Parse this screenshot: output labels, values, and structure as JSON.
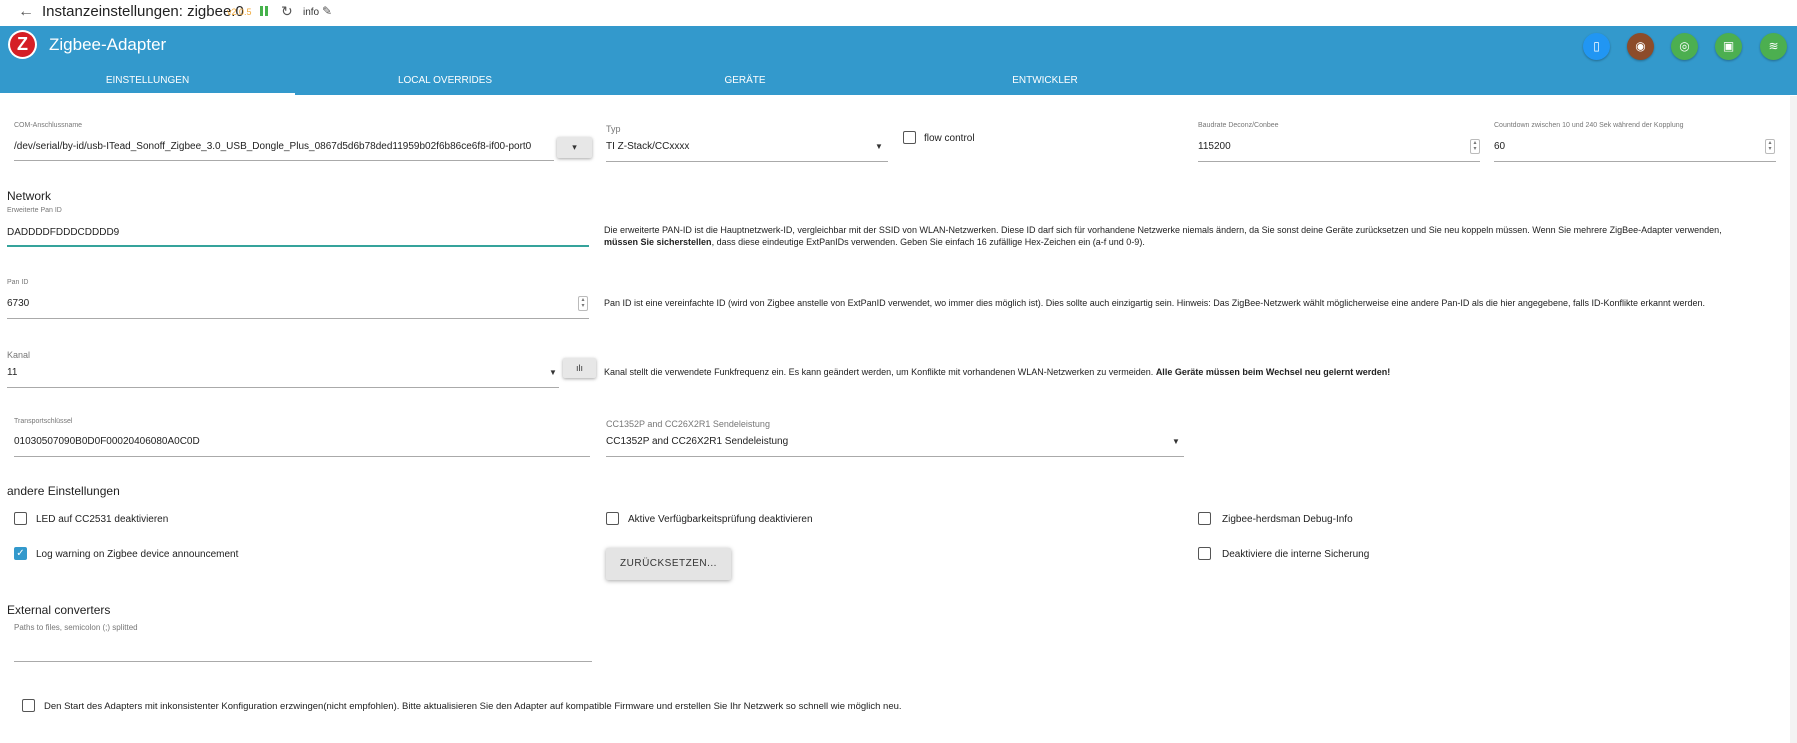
{
  "titlebar": {
    "title": "Instanzeinstellungen: zigbee.0",
    "version": "v2.0.5",
    "info_label": "info"
  },
  "header": {
    "app_title": "Zigbee-Adapter",
    "logo_letter": "Z",
    "buttons": [
      {
        "icon": "device-icon",
        "color": "#2196f3",
        "glyph": "▯"
      },
      {
        "icon": "map-icon",
        "color": "#8d4c2a",
        "glyph": "◉"
      },
      {
        "icon": "wifi-icon",
        "color": "#4caf50",
        "glyph": "◎"
      },
      {
        "icon": "chip-icon",
        "color": "#4caf50",
        "glyph": "▣"
      },
      {
        "icon": "signal-icon",
        "color": "#4caf50",
        "glyph": "≋"
      }
    ]
  },
  "tabs": [
    "EINSTELLUNGEN",
    "LOCAL OVERRIDES",
    "GERÄTE",
    "ENTWICKLER"
  ],
  "com": {
    "label": "COM-Anschlussname",
    "value": "/dev/serial/by-id/usb-ITead_Sonoff_Zigbee_3.0_USB_Dongle_Plus_0867d5d6b78ded11959b02f6b86ce6f8-if00-port0"
  },
  "typ": {
    "label": "Typ",
    "value": "TI Z-Stack/CCxxxx"
  },
  "flow_control": "flow control",
  "baud": {
    "label": "Baudrate Deconz/Conbee",
    "value": "115200"
  },
  "countdown": {
    "label": "Countdown zwischen 10 und 240 Sek während der Kopplung",
    "value": "60"
  },
  "network": {
    "heading": "Network",
    "ext_pan": {
      "label": "Erweiterte Pan ID",
      "value": "DADDDDFDDDCDDDD9",
      "desc_plain": "Die erweiterte PAN-ID ist die Hauptnetzwerk-ID, vergleichbar mit der SSID von WLAN-Netzwerken. Diese ID darf sich für vorhandene Netzwerke niemals ändern, da Sie sonst deine Geräte zurücksetzen und Sie neu koppeln müssen. Wenn Sie mehrere ZigBee-Adapter verwenden,",
      "desc_bold": "müssen Sie sicherstellen",
      "desc_rest": ", dass diese eindeutige ExtPanIDs verwenden. Geben Sie einfach 16 zufällige Hex-Zeichen ein (a-f und 0-9)."
    },
    "pan": {
      "label": "Pan ID",
      "value": "6730",
      "desc": "Pan ID ist eine vereinfachte ID (wird von Zigbee anstelle von ExtPanID verwendet, wo immer dies möglich ist). Dies sollte auch einzigartig sein. Hinweis: Das ZigBee-Netzwerk wählt möglicherweise eine andere Pan-ID als die hier angegebene, falls ID-Konflikte erkannt werden."
    },
    "kanal": {
      "label": "Kanal",
      "value": "11",
      "desc_plain": "Kanal stellt die verwendete Funkfrequenz ein. Es kann geändert werden, um Konflikte mit vorhandenen WLAN-Netzwerken zu vermeiden.",
      "desc_bold": "Alle Geräte müssen beim Wechsel neu gelernt werden!"
    },
    "transport": {
      "label": "Transportschlüssel",
      "value": "01030507090B0D0F00020406080A0C0D"
    },
    "sende": {
      "label": "CC1352P and CC26X2R1 Sendeleistung",
      "value": "CC1352P and CC26X2R1 Sendeleistung"
    }
  },
  "other": {
    "heading": "andere Einstellungen",
    "led": "LED auf CC2531 deaktivieren",
    "avail": "Aktive Verfügbarkeitsprüfung deaktivieren",
    "debug": "Zigbee-herdsman Debug-Info",
    "logwarn": "Log warning on Zigbee device announcement",
    "reset": "ZURÜCKSETZEN...",
    "backup": "Deaktiviere die interne Sicherung"
  },
  "external": {
    "heading": "External converters",
    "placeholder": "Paths to files, semicolon (;) splitted"
  },
  "force_start": "Den Start des Adapters mit inkonsistenter Konfiguration erzwingen(nicht empfohlen). Bitte aktualisieren Sie den Adapter auf kompatible Firmware und erstellen Sie Ihr Netzwerk so schnell wie möglich neu.",
  "checkbox_states": {
    "led": false,
    "avail": false,
    "debug": false,
    "logwarn": true,
    "backup": false,
    "flow": false,
    "force": false
  },
  "colors": {
    "header": "#3399cc",
    "accent_underline": "#35a39b",
    "version": "#f0a83a",
    "logo": "#d51f26"
  }
}
